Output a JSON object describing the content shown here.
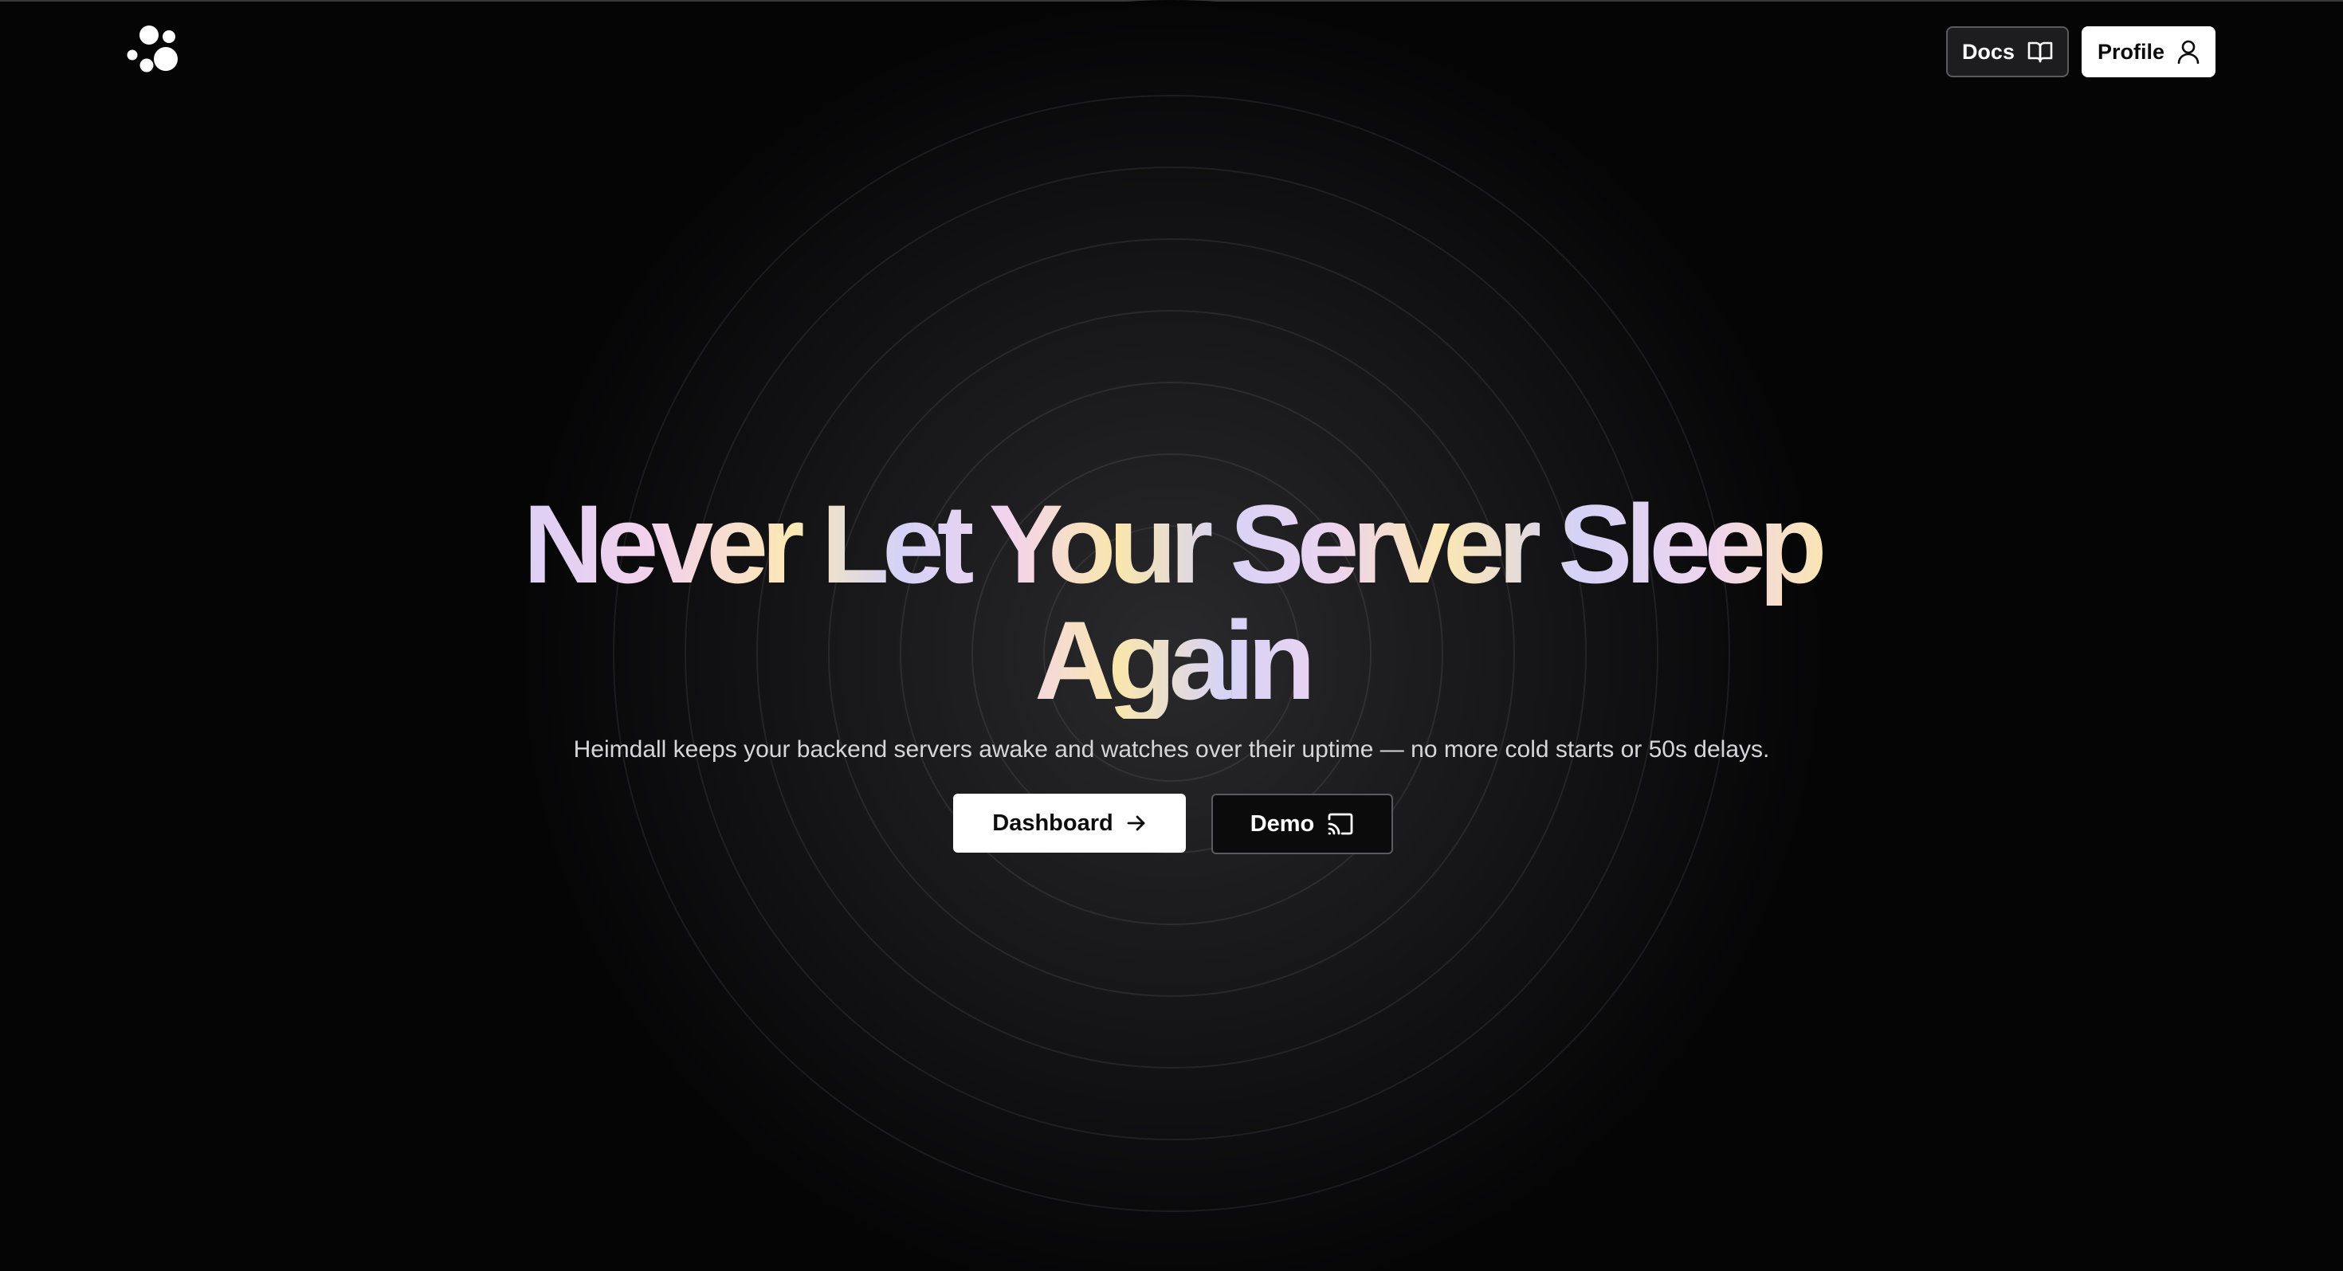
{
  "header": {
    "docs_label": "Docs",
    "profile_label": "Profile",
    "docs_icon": "book-open-icon",
    "profile_icon": "user-icon",
    "logo_icon": "dots-cluster-logo-icon"
  },
  "hero": {
    "headline": "Never Let Your Server Sleep Again",
    "tagline": "Heimdall keeps your backend servers awake and watches over their uptime — no more cold starts or 50s delays.",
    "dashboard_label": "Dashboard",
    "dashboard_icon": "arrow-right-icon",
    "demo_label": "Demo",
    "demo_icon": "cast-icon"
  },
  "colors": {
    "background": "#050506",
    "gradient_lavender": "#d8cff7",
    "gradient_pink": "#f3d2ec",
    "gradient_cream": "#fbe8b4"
  }
}
